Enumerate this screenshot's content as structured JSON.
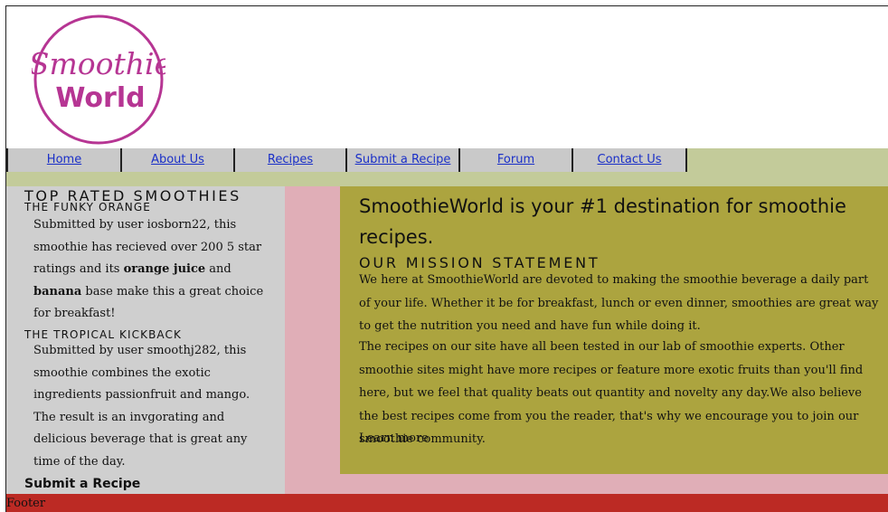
{
  "logo": {
    "line1": "Smoothie",
    "line2": "World",
    "color": "#b63593"
  },
  "nav": {
    "items": [
      {
        "label": "Home"
      },
      {
        "label": "About Us"
      },
      {
        "label": "Recipes"
      },
      {
        "label": "Submit a Recipe"
      },
      {
        "label": "Forum"
      },
      {
        "label": "Contact Us"
      }
    ]
  },
  "sidebar": {
    "title": "TOP RATED SMOOTHIES",
    "items": [
      {
        "name": "THE FUNKY ORANGE",
        "text_a": "Submitted by user iosborn22, this smoothie has recieved over 200 5 star ratings and its ",
        "bold_a": "orange juice",
        "text_b": " and ",
        "bold_b": "banana",
        "text_c": " base make this a great choice for breakfast!"
      },
      {
        "name": "THE TROPICAL KICKBACK",
        "text": "Submitted by user smoothj282, this smoothie combines the exotic ingredients passionfruit and mango. The result is an invgorating and delicious beverage that is great any time of the day."
      }
    ],
    "submit_link": "Submit a Recipe"
  },
  "main": {
    "headline": "SmoothieWorld is your #1 destination for smoothie recipes.",
    "mission_title": "OUR MISSION STATEMENT",
    "para1": "We here at SmoothieWorld are devoted to making the smoothie beverage a daily part of your life. Whether it be for breakfast, lunch or even dinner, smoothies are great way to get the nutrition you need and have fun while doing it.",
    "para2": "The recipes on our site have all been tested in our lab of smoothie experts. Other smoothie sites might have more recipes or feature more exotic fruits than you'll find here, but we feel that quality beats out quantity and novelty any day.We also believe the best recipes come from you the reader, that's why we encourage you to join our smoothie community.",
    "learn_more": "Learn more"
  },
  "footer": {
    "text": "Footer"
  },
  "colors": {
    "nav_bar": "#c3cb9a",
    "nav_tab": "#c9c9c9",
    "link": "#1a2fc8",
    "sidebar": "#cfcfcf",
    "pink": "#e0aeb7",
    "main": "#aca43f",
    "footer": "#bc2a24"
  }
}
